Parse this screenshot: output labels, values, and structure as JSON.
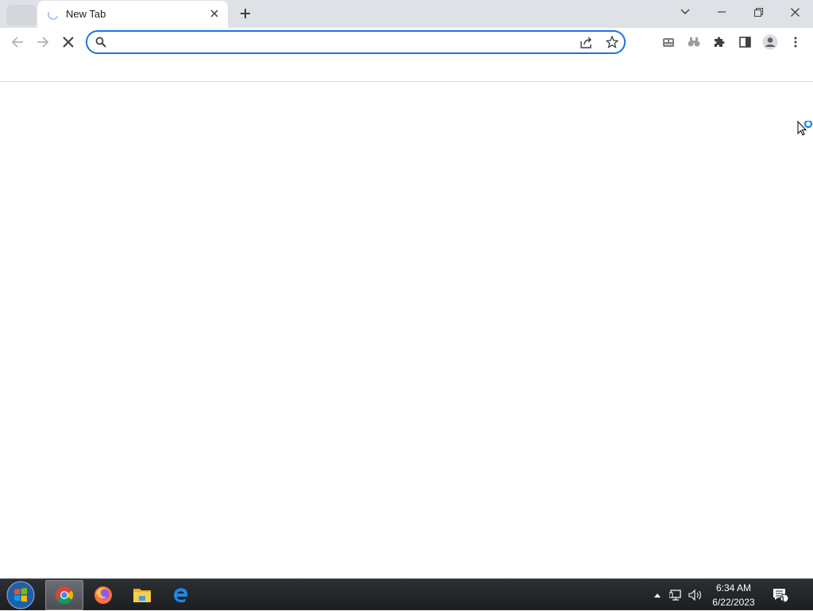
{
  "browser": {
    "tab": {
      "title": "New Tab"
    },
    "omnibox": {
      "value": "",
      "placeholder": ""
    }
  },
  "icons": {
    "tab_search": "tab-search-icon",
    "loading": "loading-spinner-icon",
    "tab_close": "close-icon",
    "new_tab": "plus-icon",
    "minimize": "minimize-icon",
    "restore": "restore-icon",
    "close_window": "close-icon",
    "back": "arrow-left-icon",
    "forward": "arrow-right-icon",
    "stop": "stop-icon",
    "search": "search-icon",
    "share": "share-icon",
    "bookmark": "star-icon",
    "extensions": [
      "extension-app-icon",
      "binoculars-icon",
      "puzzle-icon"
    ],
    "side_panel": "side-panel-icon",
    "profile": "profile-icon",
    "menu": "more-vert-icon"
  },
  "taskbar": {
    "apps": [
      "Google Chrome",
      "Firefox",
      "File Explorer",
      "Internet Explorer"
    ],
    "clock": {
      "time": "6:34 AM",
      "date": "6/22/2023"
    },
    "notification_count": "1"
  },
  "colors": {
    "accent": "#1a73e8",
    "tabstrip": "#dee1e6",
    "taskbar": "#1c1e21"
  }
}
